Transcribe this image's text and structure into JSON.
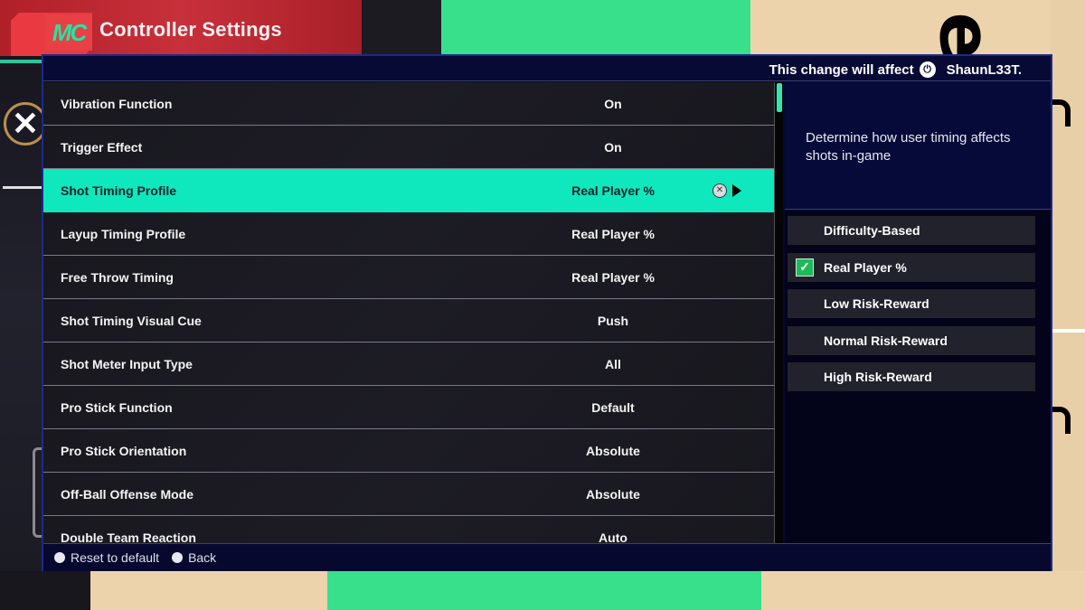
{
  "header": {
    "logo_text": "MC",
    "title": "Controller Settings"
  },
  "topbar": {
    "affect_label": "This change will affect",
    "platform_icon": "playstation-icon",
    "username": "ShaunL33T."
  },
  "settings": [
    {
      "label": "Vibration Function",
      "value": "On"
    },
    {
      "label": "Trigger Effect",
      "value": "On"
    },
    {
      "label": "Shot Timing Profile",
      "value": "Real Player %",
      "selected": true
    },
    {
      "label": "Layup Timing Profile",
      "value": "Real Player %"
    },
    {
      "label": "Free Throw Timing",
      "value": "Real Player %"
    },
    {
      "label": "Shot Timing Visual Cue",
      "value": "Push"
    },
    {
      "label": "Shot Meter Input Type",
      "value": "All"
    },
    {
      "label": "Pro Stick Function",
      "value": "Default"
    },
    {
      "label": "Pro Stick Orientation",
      "value": "Absolute"
    },
    {
      "label": "Off-Ball Offense Mode",
      "value": "Absolute"
    },
    {
      "label": "Double Team Reaction",
      "value": "Auto"
    }
  ],
  "selected_row_action": {
    "button_icon": "x-button-icon",
    "arrow_icon": "arrow-right-icon"
  },
  "description": "Determine how user timing affects shots in-game",
  "options": [
    {
      "label": "Difficulty-Based",
      "checked": false
    },
    {
      "label": "Real Player %",
      "checked": true
    },
    {
      "label": "Low Risk-Reward",
      "checked": false
    },
    {
      "label": "Normal Risk-Reward",
      "checked": false
    },
    {
      "label": "High Risk-Reward",
      "checked": false
    }
  ],
  "footer": {
    "reset_label": "Reset to default",
    "back_label": "Back"
  },
  "colors": {
    "accent": "#0fe8bc",
    "panel": "#06082e",
    "check": "#1dba5a"
  }
}
